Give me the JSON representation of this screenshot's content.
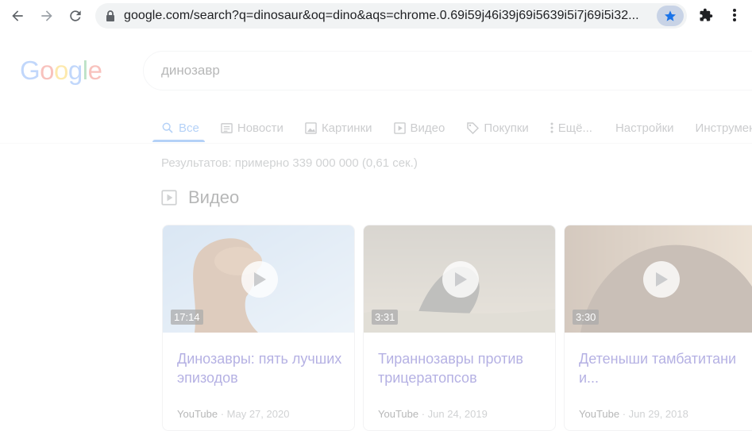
{
  "browser": {
    "url": "google.com/search?q=dinosaur&oq=dino&aqs=chrome.0.69i59j46i39j69i5639i5i7j69i5i32...",
    "colors": {
      "bookmark_star": "#1a73e8",
      "omnibox_bg": "#f1f3f4"
    }
  },
  "page": {
    "logo": [
      "G",
      "o",
      "o",
      "g",
      "l",
      "e"
    ],
    "logo_colors": [
      "#4285f4",
      "#ea4335",
      "#fbbc05",
      "#4285f4",
      "#34a853",
      "#ea4335"
    ],
    "search_value": "динозавр",
    "tabs": [
      {
        "label": "Все",
        "icon": "search-icon"
      },
      {
        "label": "Новости",
        "icon": "news-icon"
      },
      {
        "label": "Картинки",
        "icon": "image-icon"
      },
      {
        "label": "Видео",
        "icon": "video-icon"
      },
      {
        "label": "Покупки",
        "icon": "tag-icon"
      },
      {
        "label": "Ещё...",
        "icon": "more-vert-icon"
      },
      {
        "label": "Настройки",
        "icon": ""
      },
      {
        "label": "Инструменты",
        "icon": ""
      }
    ],
    "stats": "Результатов: примерно 339 000 000 (0,61 сек.)",
    "video_section_title": "Видео",
    "videos": [
      {
        "title": "Динозавры: пять лучших эпизодов",
        "duration": "17:14",
        "source": "YouTube",
        "date": "May 27, 2020"
      },
      {
        "title": "Тираннозавры против трицератопсов",
        "duration": "3:31",
        "source": "YouTube",
        "date": "Jun 24, 2019"
      },
      {
        "title": "Детеныши тамбатитани и...",
        "duration": "3:30",
        "source": "YouTube",
        "date": "Jun 29, 2018"
      }
    ]
  }
}
